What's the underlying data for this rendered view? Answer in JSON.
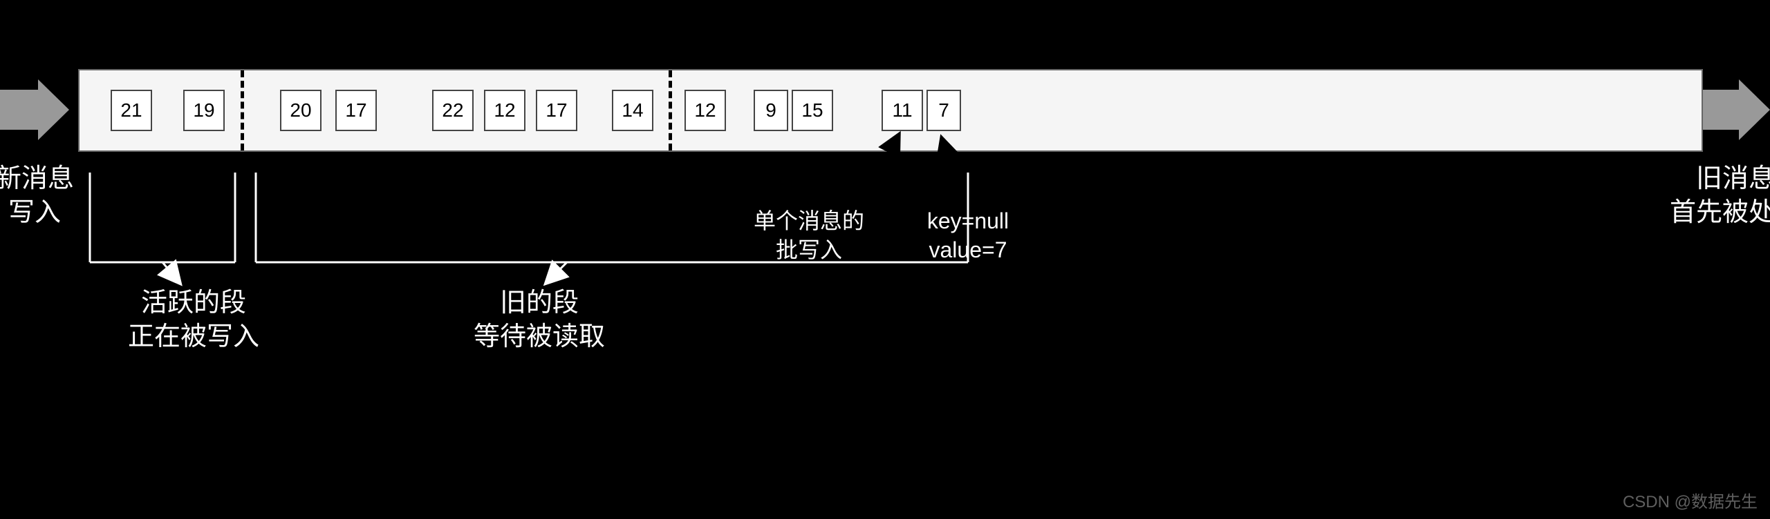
{
  "queue": {
    "batches": [
      [
        "21",
        "19"
      ],
      [
        "20",
        "17",
        "22",
        "12",
        "17",
        "14"
      ],
      [
        "12",
        "9",
        "15",
        "11",
        "7"
      ]
    ]
  },
  "labels": {
    "left_arrow_main": "新消息",
    "left_arrow_sub": "写入",
    "right_arrow_main": "旧消息",
    "right_arrow_sub": "首先被处理",
    "active_segment_line1": "活跃的段",
    "active_segment_line2": "正在被写入",
    "old_segment_line1": "旧的段",
    "old_segment_line2": "等待被读取",
    "batch_line1": "单个消息的",
    "batch_line2": "批写入",
    "key_line1": "key=null",
    "key_line2": "value=7"
  },
  "watermark": "CSDN @数据先生"
}
